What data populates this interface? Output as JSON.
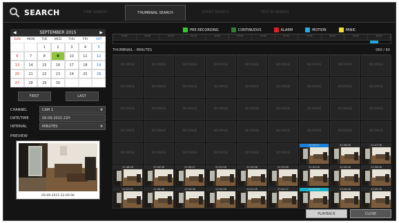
{
  "header": {
    "title": "SEARCH",
    "tabs": [
      {
        "label": "TIME SEARCH",
        "active": false
      },
      {
        "label": "THUMBNAIL SEARCH",
        "active": true
      },
      {
        "label": "EVENT SEARCH",
        "active": false
      },
      {
        "label": "TEXT-IN SEARCH",
        "active": false
      }
    ]
  },
  "calendar": {
    "month_label": "SEPTEMBER 2015",
    "dow": [
      "SUN",
      "MON",
      "TUE",
      "WED",
      "THU",
      "FRI",
      "SAT"
    ],
    "weeks": [
      [
        "",
        "",
        "1",
        "2",
        "3",
        "4",
        "5"
      ],
      [
        "6",
        "7",
        "8",
        "9",
        "10",
        "11",
        "12"
      ],
      [
        "13",
        "14",
        "15",
        "16",
        "17",
        "18",
        "19"
      ],
      [
        "20",
        "21",
        "22",
        "23",
        "24",
        "25",
        "26"
      ],
      [
        "27",
        "28",
        "29",
        "30",
        "",
        "",
        ""
      ]
    ],
    "selected": "9",
    "first_label": "FIRST",
    "last_label": "LAST"
  },
  "fields": {
    "channel_label": "CHANNEL",
    "channel_value": "CAM 1",
    "datetime_label": "DATE/TIME",
    "datetime_value": "09-09-2015 22H",
    "interval_label": "INTERVAL",
    "interval_value": "MINUTES"
  },
  "preview": {
    "label": "PREVIEW",
    "timestamp": "09-09-2015 22:00:06"
  },
  "legend": [
    {
      "label": "PRE RECORDING",
      "color": "#33cc33"
    },
    {
      "label": "CONTINUOUS",
      "color": "#2e7d32"
    },
    {
      "label": "ALARM",
      "color": "#dd2222"
    },
    {
      "label": "MOTION",
      "color": "#2aa8e0"
    },
    {
      "label": "PANIC",
      "color": "#eedd33"
    }
  ],
  "timeline_labels": [
    "22:00",
    "22:05",
    "22:10",
    "22:15",
    "22:20",
    "22:25",
    "22:30",
    "22:35",
    "22:40",
    "22:45",
    "22:50",
    "22:55"
  ],
  "thumbs": {
    "header_left": "THUMBNAIL : MINUTES",
    "header_right": "060 / 60",
    "no_image_text": "NO IMAGE",
    "img_labels": [
      "22:45:07",
      "22:46:06",
      "22:47:06",
      "22:48:06",
      "22:49:06",
      "22:50:07",
      "22:51:06",
      "22:52:06",
      "22:53:06",
      "22:54:06",
      "22:55:06",
      "22:56:06",
      "22:57:07",
      "22:58:06",
      "22:59:06",
      "23:00:06",
      "23:01:06",
      "23:02:07",
      "23:03:06",
      "23:04:06",
      "23:05:06"
    ]
  },
  "footer": {
    "playback_label": "PLAYBACK",
    "close_label": "CLOSE"
  }
}
